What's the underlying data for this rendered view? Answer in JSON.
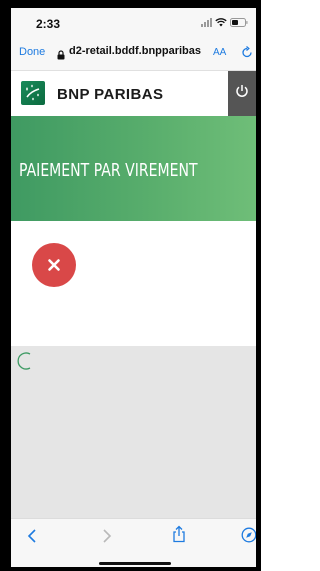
{
  "status_bar": {
    "time": "2:33",
    "icons": [
      "cellular-signal-icon",
      "wifi-icon",
      "battery-icon"
    ]
  },
  "browser_bar": {
    "done_label": "Done",
    "lock_icon": "lock-icon",
    "url": "d2-retail.bddf.bnpparibas",
    "text_size_label": "AA",
    "reload_icon": "reload-icon",
    "accent_color": "#1e7be0"
  },
  "site_header": {
    "brand_name": "BNP PARIBAS",
    "logo_icon": "bnp-paribas-logo-icon",
    "power_icon": "power-icon",
    "brand_color": "#0b7a4b"
  },
  "page": {
    "title": "PAIEMENT PAR VIREMENT",
    "banner_color": "#4fa566",
    "result_icon": "error-x-icon",
    "result_color": "#d94848",
    "loading_icon": "loading-spinner-icon"
  },
  "browser_toolbar": {
    "icons": [
      "back-chevron-icon",
      "forward-chevron-icon",
      "share-icon",
      "compass-icon"
    ]
  }
}
